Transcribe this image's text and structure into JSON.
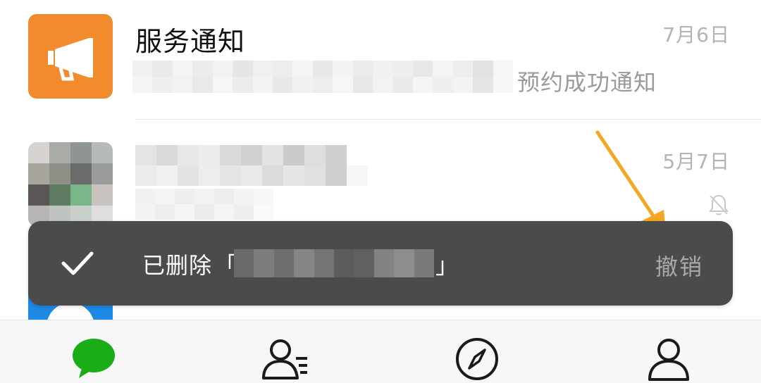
{
  "chats": [
    {
      "title": "服务通知",
      "time": "7月6日",
      "preview": "预约成功通知",
      "avatar_icon": "megaphone-icon",
      "avatar_color": "#f28a2e"
    },
    {
      "time": "5月7日",
      "muted_icon": "bell-off-icon"
    }
  ],
  "toast": {
    "check_icon": "check-icon",
    "message": "已删除",
    "bracket_open": "「",
    "bracket_close": "」",
    "undo_label": "撤销"
  },
  "tabbar": {
    "items": [
      {
        "icon": "chat-bubble-icon",
        "active": true,
        "color": "#1aad19"
      },
      {
        "icon": "contacts-icon",
        "active": false
      },
      {
        "icon": "compass-icon",
        "active": false
      },
      {
        "icon": "person-icon",
        "active": false
      }
    ]
  },
  "colors": {
    "accent_green": "#1aad19",
    "toast_bg": "#4b4b4b",
    "arrow_orange": "#f5a623"
  }
}
